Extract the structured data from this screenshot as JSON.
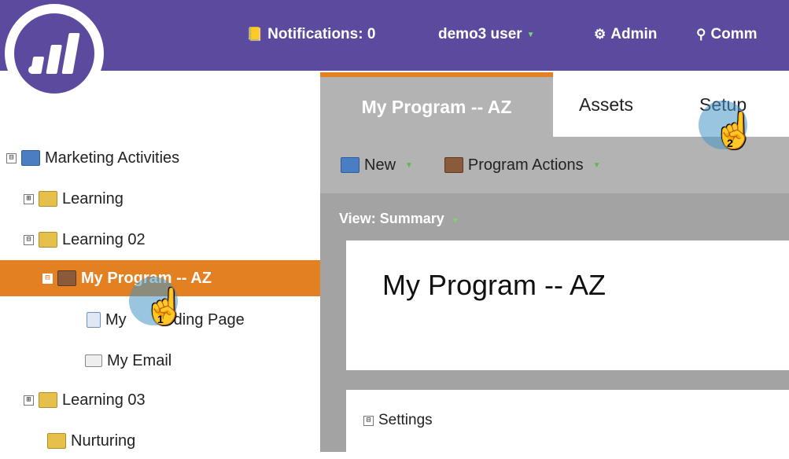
{
  "topbar": {
    "notifications": "Notifications: 0",
    "user": "demo3 user",
    "admin": "Admin",
    "community": "Comm"
  },
  "tree": {
    "items": [
      {
        "label": "Marketing Activities",
        "expander": "⊟"
      },
      {
        "label": "Learning",
        "expander": "⊞"
      },
      {
        "label": "Learning 02",
        "expander": "⊟"
      },
      {
        "label": "My Program -- AZ",
        "expander": "⊟"
      },
      {
        "label": "My Landing Page",
        "visible_label_left": "My",
        "visible_label_right": "ding Page"
      },
      {
        "label": "My Email"
      },
      {
        "label": "Learning 03",
        "expander": "⊞"
      },
      {
        "label": "Nurturing"
      }
    ]
  },
  "tabs": [
    "My Program -- AZ",
    "Assets",
    "Setup"
  ],
  "toolbar": {
    "new": "New",
    "program_actions": "Program Actions"
  },
  "view": "View: Summary",
  "card_title": "My Program -- AZ",
  "settings": "Settings",
  "cursors": [
    "1",
    "2"
  ],
  "colors": {
    "topbar": "#5b4a9e",
    "accent": "#e38022",
    "panel": "#a3a3a3"
  }
}
